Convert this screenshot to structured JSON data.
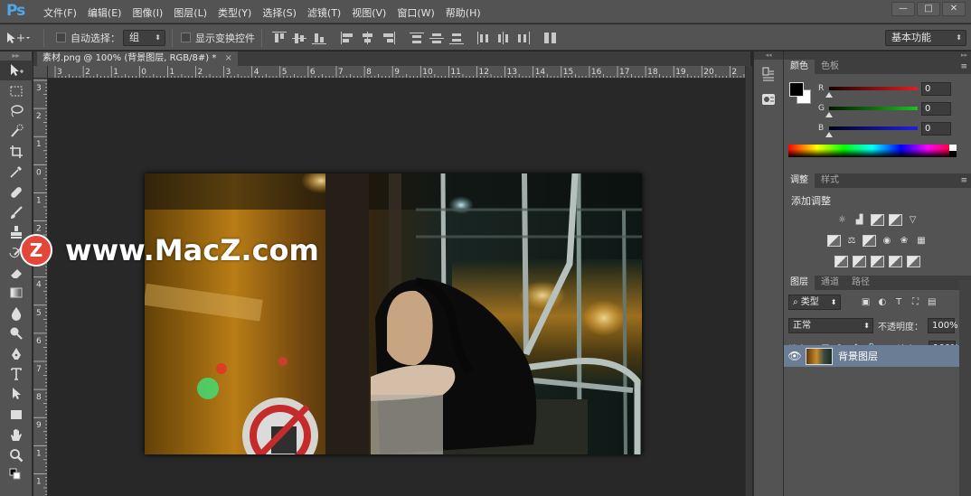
{
  "app": {
    "logo": "Ps"
  },
  "menu": [
    "文件(F)",
    "编辑(E)",
    "图像(I)",
    "图层(L)",
    "类型(Y)",
    "选择(S)",
    "滤镜(T)",
    "视图(V)",
    "窗口(W)",
    "帮助(H)"
  ],
  "window_controls": [
    "—",
    "□",
    "✕"
  ],
  "options_bar": {
    "auto_select_label": "自动选择：",
    "auto_select_value": "组",
    "show_transform_label": "显示变换控件",
    "workspace": "基本功能"
  },
  "document": {
    "tab_title": "素材.png @ 100% (背景图层, RGB/8#) *",
    "close": "×"
  },
  "rulers": {
    "top": [
      "3",
      "2",
      "1",
      "0",
      "1",
      "2",
      "3",
      "4",
      "5",
      "6",
      "7",
      "8",
      "9",
      "10",
      "11",
      "12",
      "13",
      "14",
      "15",
      "16",
      "17",
      "18",
      "19",
      "20",
      "2"
    ],
    "left": [
      "3",
      "2",
      "1",
      "0",
      "1",
      "2",
      "3",
      "4",
      "5",
      "6",
      "7",
      "8",
      "9",
      "1",
      "1"
    ]
  },
  "watermark": {
    "badge": "Z",
    "text": "www.MacZ.com"
  },
  "color_panel": {
    "tabs": [
      "颜色",
      "色板"
    ],
    "channels": [
      {
        "letter": "R",
        "value": "0",
        "gradient": "#e02020"
      },
      {
        "letter": "G",
        "value": "0",
        "gradient": "#20c020"
      },
      {
        "letter": "B",
        "value": "0",
        "gradient": "#2020e0"
      }
    ]
  },
  "adjustments_panel": {
    "tabs": [
      "调整",
      "样式"
    ],
    "title": "添加调整"
  },
  "layers_panel": {
    "tabs": [
      "图层",
      "通道",
      "路径"
    ],
    "filter_kind": "类型",
    "blend_mode": "正常",
    "opacity_label": "不透明度：",
    "opacity_value": "100%",
    "lock_label": "锁定：",
    "fill_label": "填充：",
    "fill_value": "100%",
    "layers": [
      {
        "name": "背景图层"
      }
    ]
  },
  "colors": {
    "accent": "#4fa6e8",
    "selected_layer": "#6b7d95"
  }
}
